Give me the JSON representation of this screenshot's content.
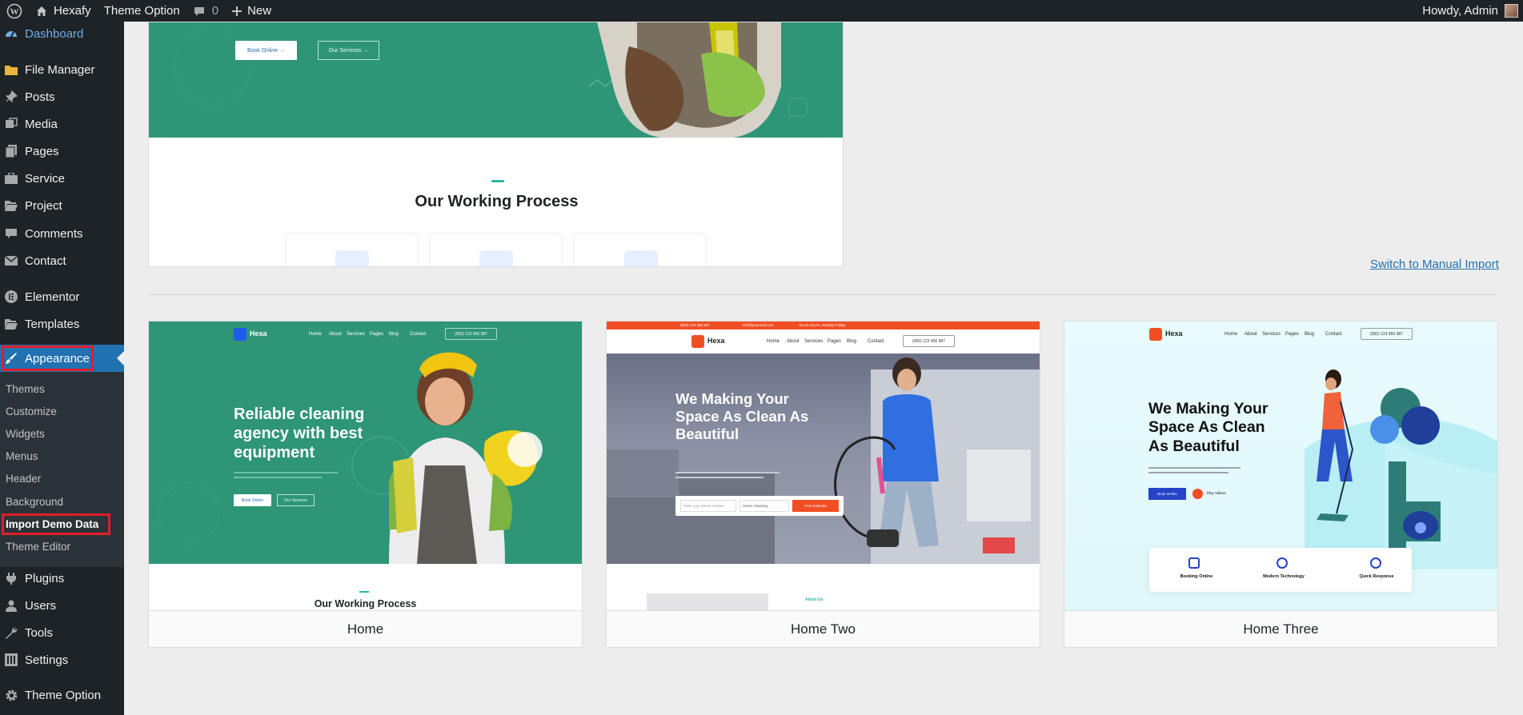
{
  "admin_bar": {
    "site_name": "Hexafy",
    "theme_option": "Theme Option",
    "comments_count": "0",
    "new_label": "New",
    "howdy": "Howdy, Admin"
  },
  "sidebar": {
    "items": [
      {
        "label": "Dashboard",
        "icon": "dashboard-icon"
      },
      {
        "label": "File Manager",
        "icon": "folder-icon"
      },
      {
        "label": "Posts",
        "icon": "pin-icon"
      },
      {
        "label": "Media",
        "icon": "media-icon"
      },
      {
        "label": "Pages",
        "icon": "pages-icon"
      },
      {
        "label": "Service",
        "icon": "portfolio-icon"
      },
      {
        "label": "Project",
        "icon": "folder-open-icon"
      },
      {
        "label": "Comments",
        "icon": "comment-icon"
      },
      {
        "label": "Contact",
        "icon": "mail-icon"
      },
      {
        "label": "Elementor",
        "icon": "elementor-icon"
      },
      {
        "label": "Templates",
        "icon": "folder-open-icon"
      },
      {
        "label": "Appearance",
        "icon": "brush-icon"
      },
      {
        "label": "Plugins",
        "icon": "plugin-icon"
      },
      {
        "label": "Users",
        "icon": "users-icon"
      },
      {
        "label": "Tools",
        "icon": "wrench-icon"
      },
      {
        "label": "Settings",
        "icon": "settings-icon"
      },
      {
        "label": "Theme Option",
        "icon": "gear-icon"
      }
    ],
    "submenu": [
      {
        "label": "Themes"
      },
      {
        "label": "Customize"
      },
      {
        "label": "Widgets"
      },
      {
        "label": "Menus"
      },
      {
        "label": "Header"
      },
      {
        "label": "Background"
      },
      {
        "label": "Import Demo Data"
      },
      {
        "label": "Theme Editor"
      }
    ]
  },
  "main": {
    "top_preview": {
      "book_online": "Book Online",
      "our_services": "Our Services",
      "section_title": "Our Working Process"
    },
    "manual_import_link": "Switch to Manual Import",
    "demos": [
      {
        "label": "Home",
        "logo": "Hexa",
        "headline": [
          "Reliable cleaning",
          "agency with best",
          "equipment"
        ],
        "nav": [
          "Home",
          "About",
          "Services",
          "Pages",
          "Blog",
          "Contact"
        ],
        "phone": "(000) 123 456 987",
        "book_online": "Book Online",
        "our_services": "Our Services",
        "section_title": "Our Working Process"
      },
      {
        "label": "Home Two",
        "logo": "Hexa",
        "headline": [
          "We Making Your",
          "Space As Clean As",
          "Beautiful"
        ],
        "nav": [
          "Home",
          "About",
          "Services",
          "Pages",
          "Blog",
          "Contact"
        ],
        "topbar": [
          "(000) 123 456 987",
          "info@yourmail.com",
          "10 am-10 pm, Sunday-Friday"
        ],
        "phone": "(000) 123 456 987",
        "input_placeholder": "Enter your phone number",
        "select_value": "Home Cleaning",
        "estimate_button": "Free Estimate",
        "about_tag": "About Us"
      },
      {
        "label": "Home Three",
        "logo": "Hexa",
        "headline": [
          "We Making Your",
          "Space As Clean",
          "As Beautiful"
        ],
        "nav": [
          "Home",
          "About",
          "Services",
          "Pages",
          "Blog",
          "Contact"
        ],
        "phone": "(000) 123 456 987",
        "book_online": "Book Online",
        "play_videos": "Play Videos",
        "features": [
          "Booking Online",
          "Modern Technology",
          "Quick Response"
        ]
      }
    ]
  },
  "colors": {
    "admin_dark": "#1d2327",
    "admin_blue": "#2271b1",
    "highlight_red": "#e11d2b",
    "theme_green": "#2e9577",
    "theme_orange": "#f04e23"
  }
}
